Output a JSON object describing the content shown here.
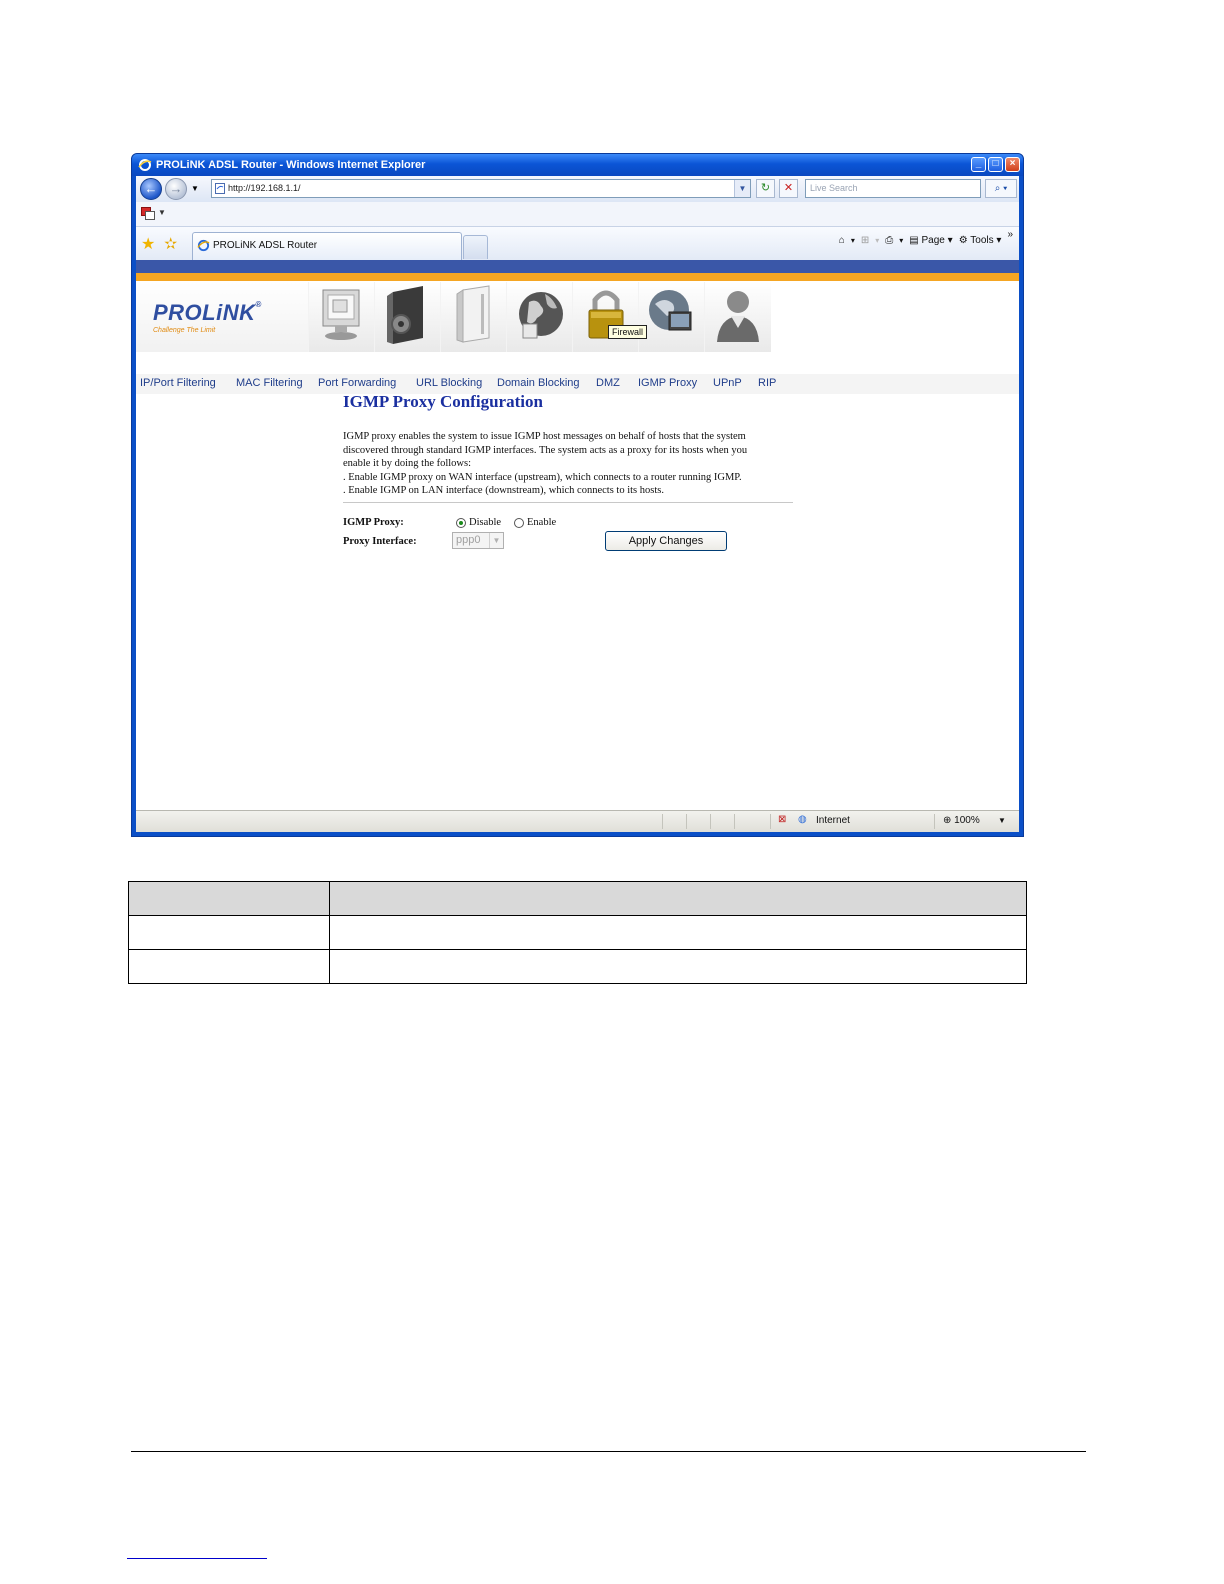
{
  "window": {
    "title": "PROLiNK ADSL Router - Windows Internet Explorer"
  },
  "address_bar": {
    "url": "http://192.168.1.1/"
  },
  "search": {
    "placeholder": "Live Search"
  },
  "tab": {
    "label": "PROLiNK ADSL Router"
  },
  "command_bar": {
    "page_label": "Page",
    "tools_label": "Tools",
    "overflow": "»"
  },
  "brand": {
    "logo": "PROLiNK",
    "slogan": "Challenge The Limit"
  },
  "nav_icons": [
    {
      "name": "status-icon"
    },
    {
      "name": "setup-icon"
    },
    {
      "name": "advanced-icon"
    },
    {
      "name": "service-icon"
    },
    {
      "name": "firewall-icon"
    },
    {
      "name": "maintenance-icon"
    },
    {
      "name": "admin-icon"
    }
  ],
  "tooltip": "Firewall",
  "submenu": [
    "IP/Port Filtering",
    "MAC Filtering",
    "Port Forwarding",
    "URL Blocking",
    "Domain Blocking",
    "DMZ",
    "IGMP Proxy",
    "UPnP",
    "RIP"
  ],
  "config": {
    "title": "IGMP Proxy Configuration",
    "description": [
      "IGMP proxy enables the system to issue IGMP host messages on behalf of hosts that the system",
      "discovered through standard IGMP interfaces. The system acts as a proxy for its hosts when you",
      "enable it by doing the follows:",
      ". Enable IGMP proxy on WAN interface (upstream), which connects to a router running IGMP.",
      ". Enable IGMP on LAN interface (downstream), which connects to its hosts."
    ],
    "igmp_proxy_label": "IGMP Proxy:",
    "disable_label": "Disable",
    "enable_label": "Enable",
    "selected": "Disable",
    "proxy_interface_label": "Proxy Interface:",
    "proxy_interface_value": "ppp0",
    "apply_label": "Apply Changes"
  },
  "statusbar": {
    "zone": "Internet",
    "zoom": "100%"
  },
  "colors": {
    "stripe_blue": "#3a57a8",
    "stripe_orange": "#f5a623",
    "title_blue": "#1a2fa0"
  }
}
